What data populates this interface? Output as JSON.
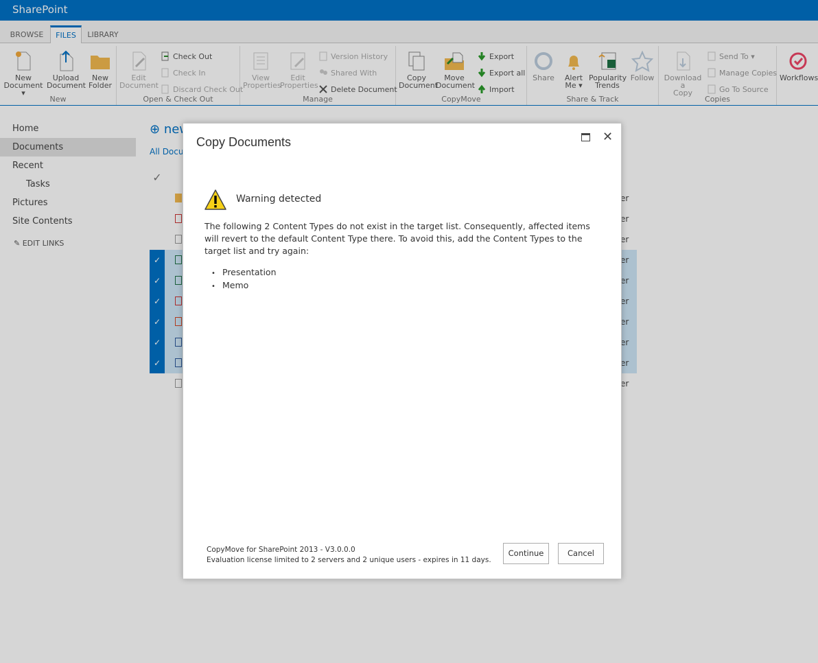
{
  "app": {
    "brand": "SharePoint"
  },
  "tabs": [
    "BROWSE",
    "FILES",
    "LIBRARY"
  ],
  "ribbon": {
    "groups": {
      "new": "New",
      "open_checkout": "Open & Check Out",
      "manage": "Manage",
      "copymove": "CopyMove",
      "share_track": "Share & Track",
      "copies": "Copies"
    },
    "new_document": [
      "New",
      "Document"
    ],
    "upload_document": [
      "Upload",
      "Document"
    ],
    "new_folder": [
      "New",
      "Folder"
    ],
    "edit_document": [
      "Edit",
      "Document"
    ],
    "check_out": "Check Out",
    "check_in": "Check In",
    "discard_check_out": "Discard Check Out",
    "view_properties": [
      "View",
      "Properties"
    ],
    "edit_properties": [
      "Edit",
      "Properties"
    ],
    "version_history": "Version History",
    "shared_with": "Shared With",
    "delete_document": "Delete Document",
    "copy_document": [
      "Copy",
      "Document"
    ],
    "move_document": [
      "Move",
      "Document"
    ],
    "export": "Export",
    "export_all": "Export all",
    "import": "Import",
    "share": "Share",
    "alert_me": [
      "Alert",
      "Me"
    ],
    "popularity_trends": [
      "Popularity",
      "Trends"
    ],
    "follow": "Follow",
    "download_copy": [
      "Download a",
      "Copy"
    ],
    "send_to": "Send To",
    "manage_copies": "Manage Copies",
    "go_to_source": "Go To Source",
    "workflows": "Workflows"
  },
  "leftnav": {
    "home": "Home",
    "documents": "Documents",
    "recent": "Recent",
    "tasks": "Tasks",
    "pictures": "Pictures",
    "site_contents": "Site Contents",
    "edit_links": "EDIT LINKS"
  },
  "content": {
    "new_link": "new",
    "all_docs": "All Docu",
    "row_tail": "er"
  },
  "dialog": {
    "title": "Copy Documents",
    "warning_heading": "Warning detected",
    "message": "The following 2 Content Types do not exist in the target list. Consequently, affected items will revert to the default Content Type there. To avoid this, add the Content Types to the target list and try again:",
    "content_types": [
      "Presentation",
      "Memo"
    ],
    "footer_line1": "CopyMove for SharePoint 2013 - V3.0.0.0",
    "footer_line2": "Evaluation license limited to 2 servers and 2 unique users - expires in 11 days.",
    "continue_label": "Continue",
    "cancel_label": "Cancel"
  },
  "colors": {
    "suite_bar": "#0072c6",
    "warning_yellow": "#f7d117",
    "selected_row": "#cde6f7"
  }
}
